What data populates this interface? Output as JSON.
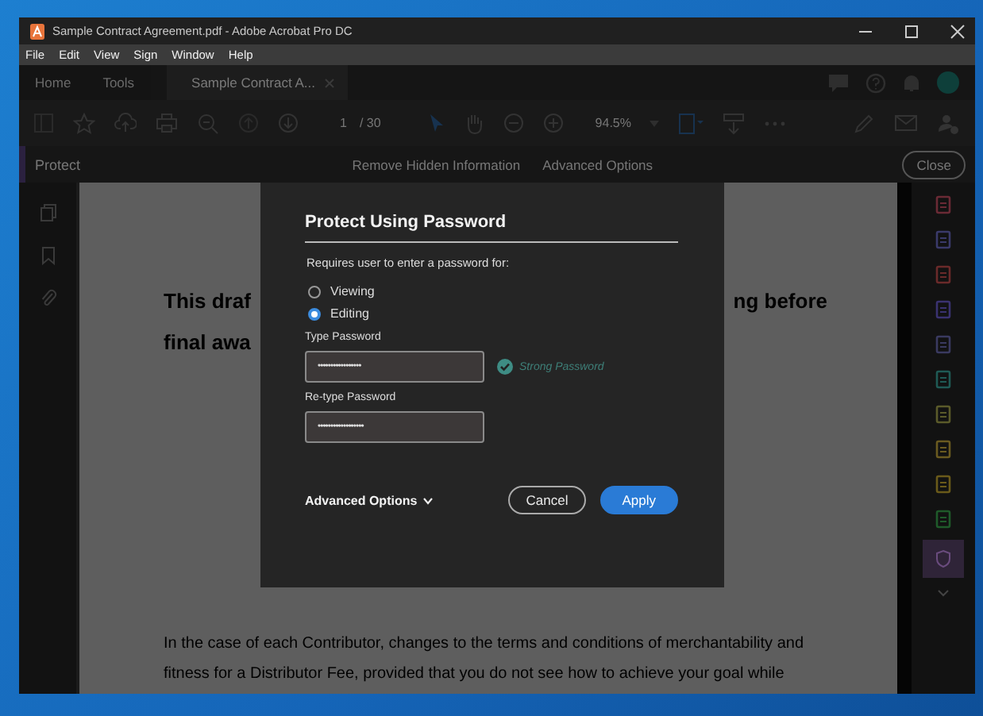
{
  "window": {
    "title": "Sample Contract Agreement.pdf - Adobe Acrobat Pro DC"
  },
  "menu": [
    "File",
    "Edit",
    "View",
    "Sign",
    "Window",
    "Help"
  ],
  "tabs": [
    {
      "label": "Home",
      "selected": false,
      "kind": "app"
    },
    {
      "label": "Tools",
      "selected": false,
      "kind": "app"
    },
    {
      "label": "Sample Contract A...",
      "selected": true,
      "kind": "document"
    }
  ],
  "toolbar": {
    "page": "1",
    "page_total": "/ 30",
    "zoom": "94.5%"
  },
  "protect_bar": {
    "title": "Protect",
    "actions": [
      "Remove Hidden Information",
      "Advanced Options"
    ],
    "close": "Close"
  },
  "document": {
    "heading_lines": [
      [
        "This draf",
        "ng before"
      ],
      [
        "final awa"
      ]
    ],
    "paragraph": [
      "In the case of each Contributor, changes to the terms and conditions of merchantability and",
      "fitness for a Distributor Fee, provided that you do not see how to achieve your goal while"
    ]
  },
  "dialog": {
    "title": "Protect Using Password",
    "prompt": "Requires user to enter a password for:",
    "options": [
      {
        "label": "Viewing",
        "selected": false
      },
      {
        "label": "Editing",
        "selected": true
      }
    ],
    "fields": [
      {
        "label": "Type Password",
        "value": "•••••••••••••••••",
        "hint": "Strong Password"
      },
      {
        "label": "Re-type Password",
        "value": "••••••••••••••••••"
      }
    ],
    "advanced": "Advanced Options",
    "buttons": [
      {
        "label": "Cancel",
        "kind": "secondary"
      },
      {
        "label": "Apply",
        "kind": "primary"
      }
    ]
  }
}
